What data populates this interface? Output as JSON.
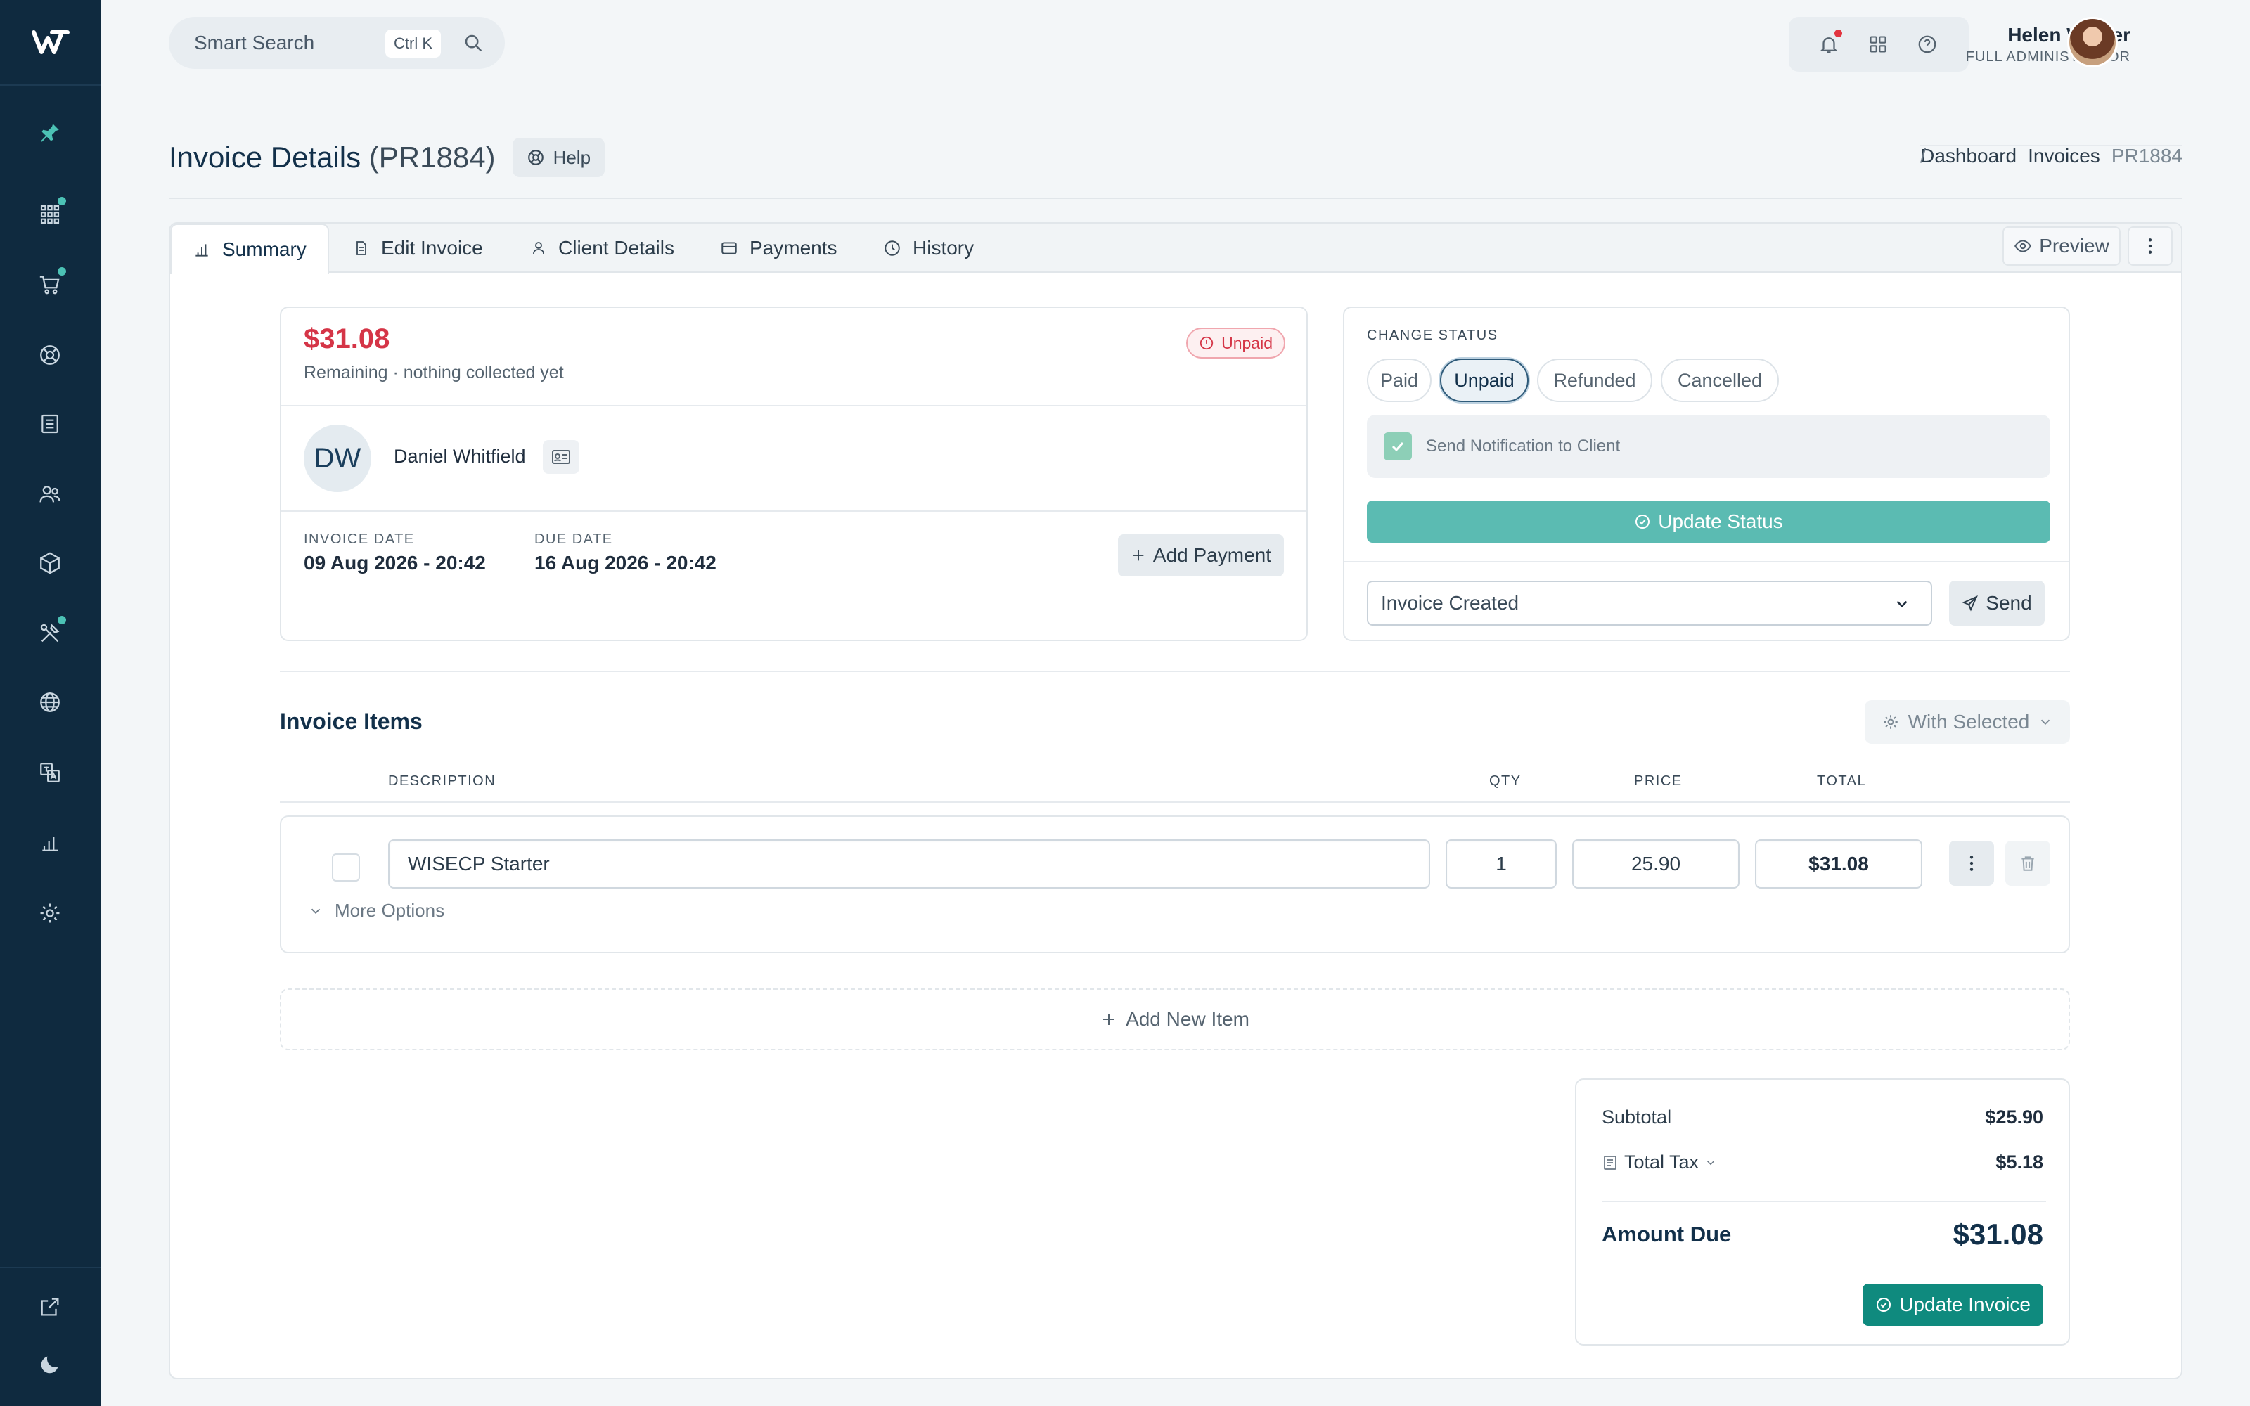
{
  "header": {
    "search_placeholder": "Smart Search",
    "search_shortcut": "Ctrl K",
    "user_name": "Helen Walker",
    "user_role": "FULL ADMINISTRATOR"
  },
  "page": {
    "title": "Invoice Details",
    "invoice_ref": "(PR1884)",
    "help_label": "Help",
    "breadcrumbs": [
      "Dashboard",
      "Invoices",
      "PR1884"
    ]
  },
  "tabs": [
    {
      "label": "Summary",
      "icon": "bar-chart-icon"
    },
    {
      "label": "Edit Invoice",
      "icon": "document-icon"
    },
    {
      "label": "Client Details",
      "icon": "user-icon"
    },
    {
      "label": "Payments",
      "icon": "credit-card-icon"
    },
    {
      "label": "History",
      "icon": "clock-icon"
    }
  ],
  "preview_label": "Preview",
  "summary": {
    "remaining_amount": "$31.08",
    "remaining_note": "Remaining · nothing collected yet",
    "status_badge": "Unpaid",
    "client_initials": "DW",
    "client_name": "Daniel Whitfield",
    "invoice_date_label": "INVOICE DATE",
    "invoice_date": "09 Aug 2026 - 20:42",
    "due_date_label": "DUE DATE",
    "due_date": "16 Aug 2026 - 20:42",
    "add_payment_label": "Add Payment"
  },
  "status_panel": {
    "label": "CHANGE STATUS",
    "options": [
      "Paid",
      "Unpaid",
      "Refunded",
      "Cancelled"
    ],
    "selected": "Unpaid",
    "notify_label": "Send Notification to Client",
    "notify_checked": true,
    "update_label": "Update Status",
    "template_selected": "Invoice Created",
    "send_label": "Send"
  },
  "items": {
    "title": "Invoice Items",
    "with_selected_label": "With Selected",
    "columns": [
      "DESCRIPTION",
      "QTY",
      "PRICE",
      "TOTAL"
    ],
    "rows": [
      {
        "description": "WISECP Starter",
        "qty": "1",
        "price": "25.90",
        "total": "$31.08"
      }
    ],
    "more_options_label": "More Options",
    "add_new_label": "Add New Item"
  },
  "totals": {
    "subtotal_label": "Subtotal",
    "subtotal": "$25.90",
    "tax_label": "Total Tax",
    "tax": "$5.18",
    "amount_due_label": "Amount Due",
    "amount_due": "$31.08",
    "update_invoice_label": "Update Invoice"
  },
  "colors": {
    "sidebar": "#0f2a3f",
    "accent_teal": "#4cc2b5",
    "unpaid_red": "#d53547",
    "update_button": "#0f8a7e"
  }
}
